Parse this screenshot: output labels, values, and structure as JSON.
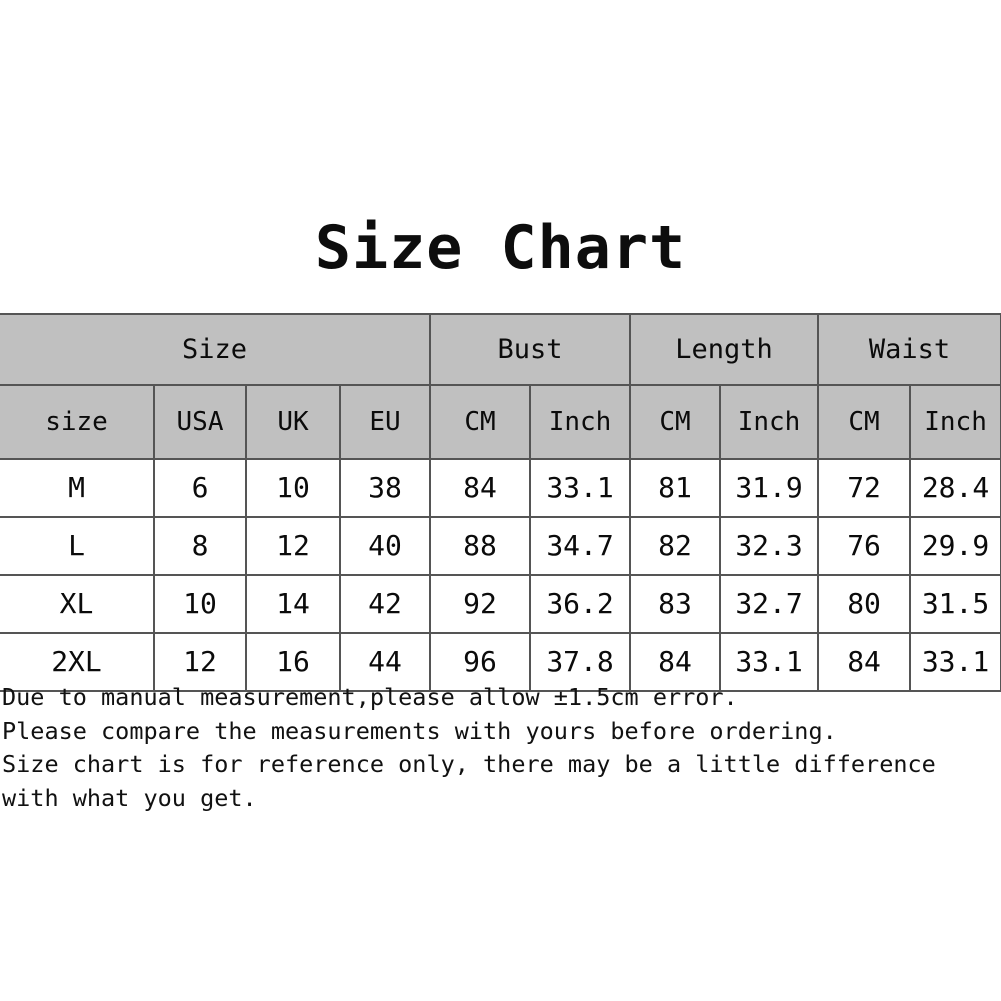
{
  "title": "Size Chart",
  "colors": {
    "header_background": "#c0c0c0",
    "cell_background": "#ffffff",
    "border": "#555555",
    "text": "#0b0b0b",
    "page_background": "#ffffff"
  },
  "table": {
    "group_headers": [
      {
        "label": "Size",
        "span": 4
      },
      {
        "label": "Bust",
        "span": 2
      },
      {
        "label": "Length",
        "span": 2
      },
      {
        "label": "Waist",
        "span": 2
      }
    ],
    "sub_headers": [
      "size",
      "USA",
      "UK",
      "EU",
      "CM",
      "Inch",
      "CM",
      "Inch",
      "CM",
      "Inch"
    ],
    "rows": [
      [
        "M",
        "6",
        "10",
        "38",
        "84",
        "33.1",
        "81",
        "31.9",
        "72",
        "28.4"
      ],
      [
        "L",
        "8",
        "12",
        "40",
        "88",
        "34.7",
        "82",
        "32.3",
        "76",
        "29.9"
      ],
      [
        "XL",
        "10",
        "14",
        "42",
        "92",
        "36.2",
        "83",
        "32.7",
        "80",
        "31.5"
      ],
      [
        "2XL",
        "12",
        "16",
        "44",
        "96",
        "37.8",
        "84",
        "33.1",
        "84",
        "33.1"
      ]
    ]
  },
  "notes": [
    "Due to manual measurement,please allow ±1.5cm error.",
    "Please compare the measurements with yours before ordering.",
    "Size chart is for reference only, there may be a little difference with what you get."
  ]
}
